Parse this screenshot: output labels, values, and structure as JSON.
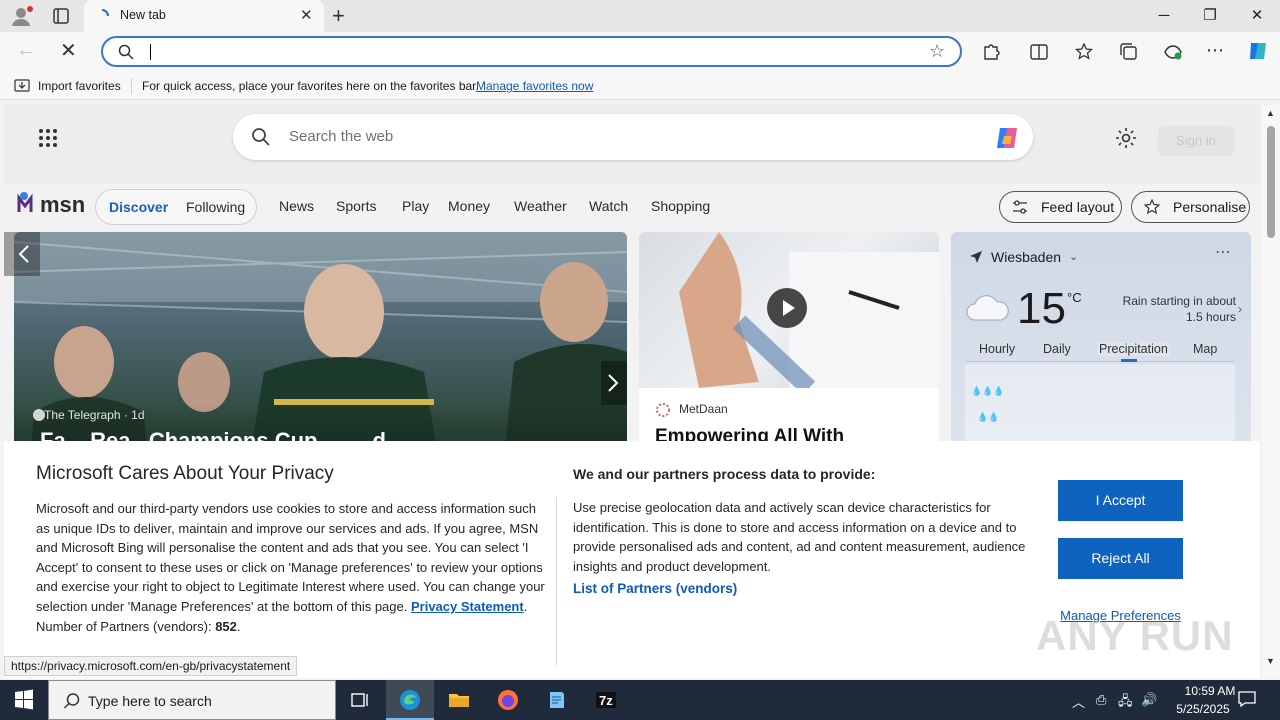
{
  "browser": {
    "tab_title": "New tab",
    "address_value": "",
    "favorites_bar": {
      "import_label": "Import favorites",
      "hint": "For quick access, place your favorites here on the favorites bar.",
      "manage_link": "Manage favorites now"
    },
    "status_url": "https://privacy.microsoft.com/en-gb/privacystatement"
  },
  "msn": {
    "search_placeholder": "Search the web",
    "signin_label": "Sign in",
    "logo_text": "msn",
    "feed_tabs": [
      "Discover",
      "Following"
    ],
    "nav": [
      "News",
      "Sports",
      "Play",
      "Money",
      "Weather",
      "Watch",
      "Shopping"
    ],
    "feed_layout_label": "Feed layout",
    "personalise_label": "Personalise",
    "hero": {
      "source": "The Telegraph",
      "age": "1d",
      "headline": "Fa...   Rea.. Champions Cup  ...   ...  d"
    },
    "video": {
      "source": "MetDaan",
      "title": "Empowering All With"
    },
    "weather": {
      "location": "Wiesbaden",
      "temp": "15",
      "unit": "°C",
      "summary": "Rain starting in about 1.5 hours",
      "tabs": [
        "Hourly",
        "Daily",
        "Precipitation",
        "Map"
      ],
      "active_tab": "Precipitation"
    }
  },
  "consent": {
    "title": "Microsoft Cares About Your Privacy",
    "body": "Microsoft and our third-party vendors use cookies to store and access information such as unique IDs to deliver, maintain and improve our services and ads. If you agree, MSN and Microsoft Bing will personalise the content and ads that you see. You can select 'I Accept' to consent to these uses or click on 'Manage preferences' to review your options and exercise your right to object to Legitimate Interest where used.  You can change your selection under 'Manage Preferences' at the bottom of this page.",
    "privacy_link": "Privacy Statement",
    "partners_count_label": "Number of Partners (vendors):",
    "partners_count": "852",
    "purpose_title": "We and our partners process data to provide:",
    "purpose_body": "Use precise geolocation data and actively scan device characteristics for identification. This is done to store and access information on a device and to provide personalised ads and content, ad and content measurement, audience insights and product development.",
    "partners_link": "List of Partners (vendors)",
    "accept_label": "I Accept",
    "reject_label": "Reject All",
    "manage_label": "Manage Preferences"
  },
  "watermark": "ANY RUN",
  "taskbar": {
    "search_placeholder": "Type here to search",
    "time": "10:59 AM",
    "date": "5/25/2025"
  },
  "colors": {
    "accent": "#0e63be",
    "link": "#0e5ab9",
    "omnibox_border": "#3b78c9",
    "taskbar": "#1f2b3a"
  }
}
